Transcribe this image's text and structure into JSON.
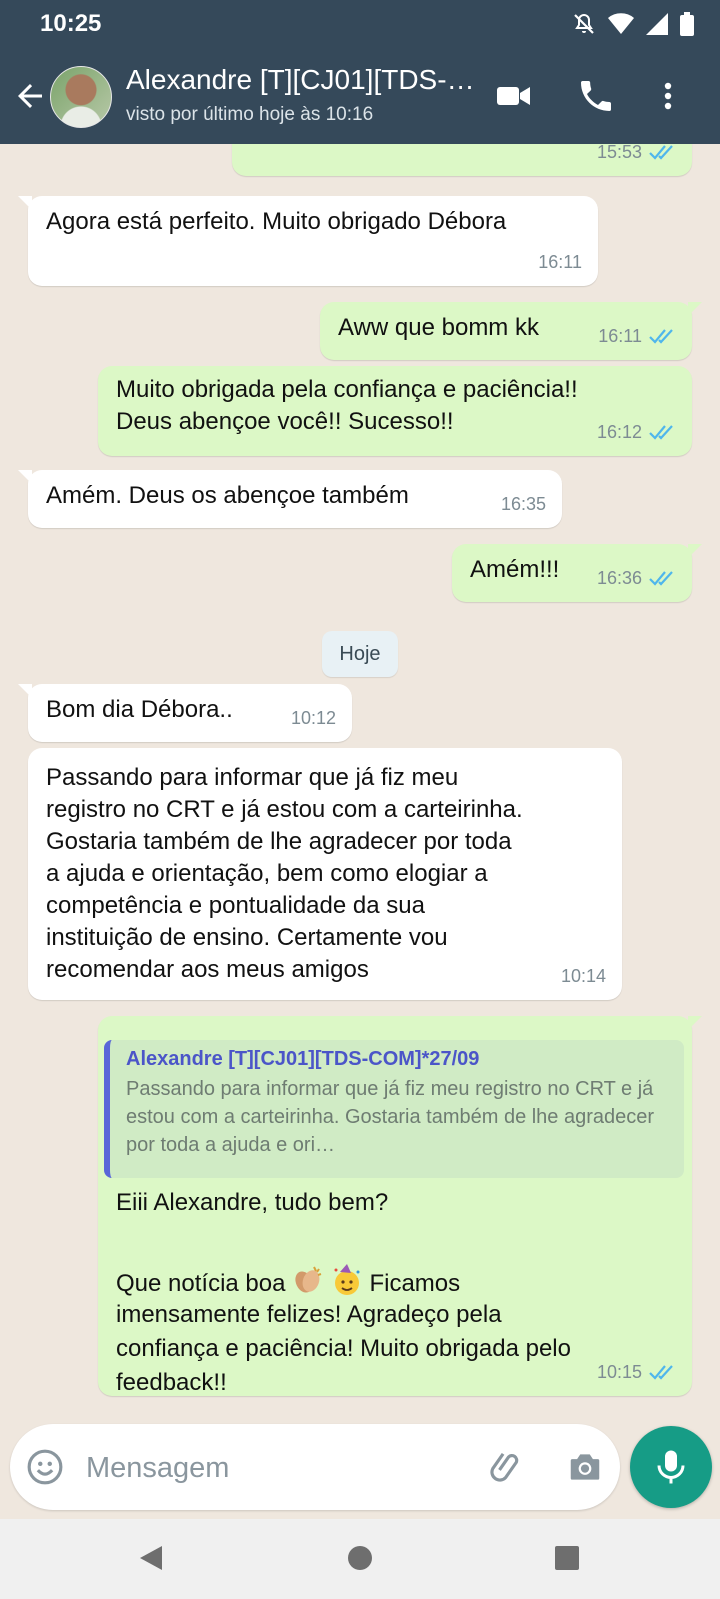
{
  "status_bar": {
    "time": "10:25",
    "icons": [
      "mute-icon",
      "wifi-icon",
      "signal-icon",
      "battery-icon"
    ]
  },
  "header": {
    "contact_name": "Alexandre  [T][CJ01][TDS-COM]*27/09",
    "contact_status": "visto por último hoje às 10:16",
    "icons": [
      "back-arrow-icon",
      "video-call-icon",
      "phone-call-icon",
      "more-options-icon"
    ]
  },
  "messages": [
    {
      "direction": "out",
      "text": "",
      "time": "15:53",
      "read": true
    },
    {
      "direction": "in",
      "text": "Agora está perfeito. Muito obrigado Débora",
      "time": "16:11"
    },
    {
      "direction": "out",
      "text": "Aww que bomm kk",
      "time": "16:11",
      "read": true
    },
    {
      "direction": "out",
      "text": "Muito obrigada pela confiança e paciência!!\nDeus abençoe você!! Sucesso!!",
      "time": "16:12",
      "read": true
    },
    {
      "direction": "in",
      "text": "Amém. Deus os abençoe também",
      "time": "16:35"
    },
    {
      "direction": "out",
      "text": "Amém!!!",
      "time": "16:36",
      "read": true
    },
    {
      "direction": "in",
      "text": "Bom dia Débora..",
      "time": "10:12"
    },
    {
      "direction": "in",
      "text": "Passando para informar que já fiz meu\nregistro no CRT e já estou com a carteirinha.\nGostaria também de lhe agradecer por toda\na ajuda e orientação, bem como elogiar a\ncompetência e pontualidade da sua\ninstituição de ensino. Certamente vou\nrecomendar aos meus amigos",
      "time": "10:14"
    },
    {
      "direction": "out",
      "quote": {
        "author": "Alexandre  [T][CJ01][TDS-COM]*27/09",
        "text": "Passando para informar que já fiz meu registro no CRT e já estou com a carteirinha. Gostaria também de lhe agradecer por toda a ajuda e ori…"
      },
      "line1": "Eiii Alexandre, tudo bem?",
      "line2_before_emoji": "Que notícia boa ",
      "emojis": [
        "clapping-hands-emoji",
        "party-face-emoji"
      ],
      "line2_after_emoji": " Ficamos",
      "rest": "imensamente felizes! Agradeço pela\nconfiança e paciência! Muito obrigada pelo\nfeedback!!",
      "time": "10:15",
      "read": true
    }
  ],
  "date_chip": "Hoje",
  "composer": {
    "placeholder": "Mensagem",
    "icons": [
      "emoji-icon",
      "attach-icon",
      "camera-icon",
      "microphone-icon"
    ]
  },
  "nav_bar": {
    "icons": [
      "back-triangle-icon",
      "home-circle-icon",
      "recents-square-icon"
    ]
  },
  "colors": {
    "header": "#35495a",
    "outgoing_bubble": "#dcf8c6",
    "incoming_bubble": "#ffffff",
    "read_ticks": "#4fb6ec",
    "mic_button": "#169c86"
  }
}
